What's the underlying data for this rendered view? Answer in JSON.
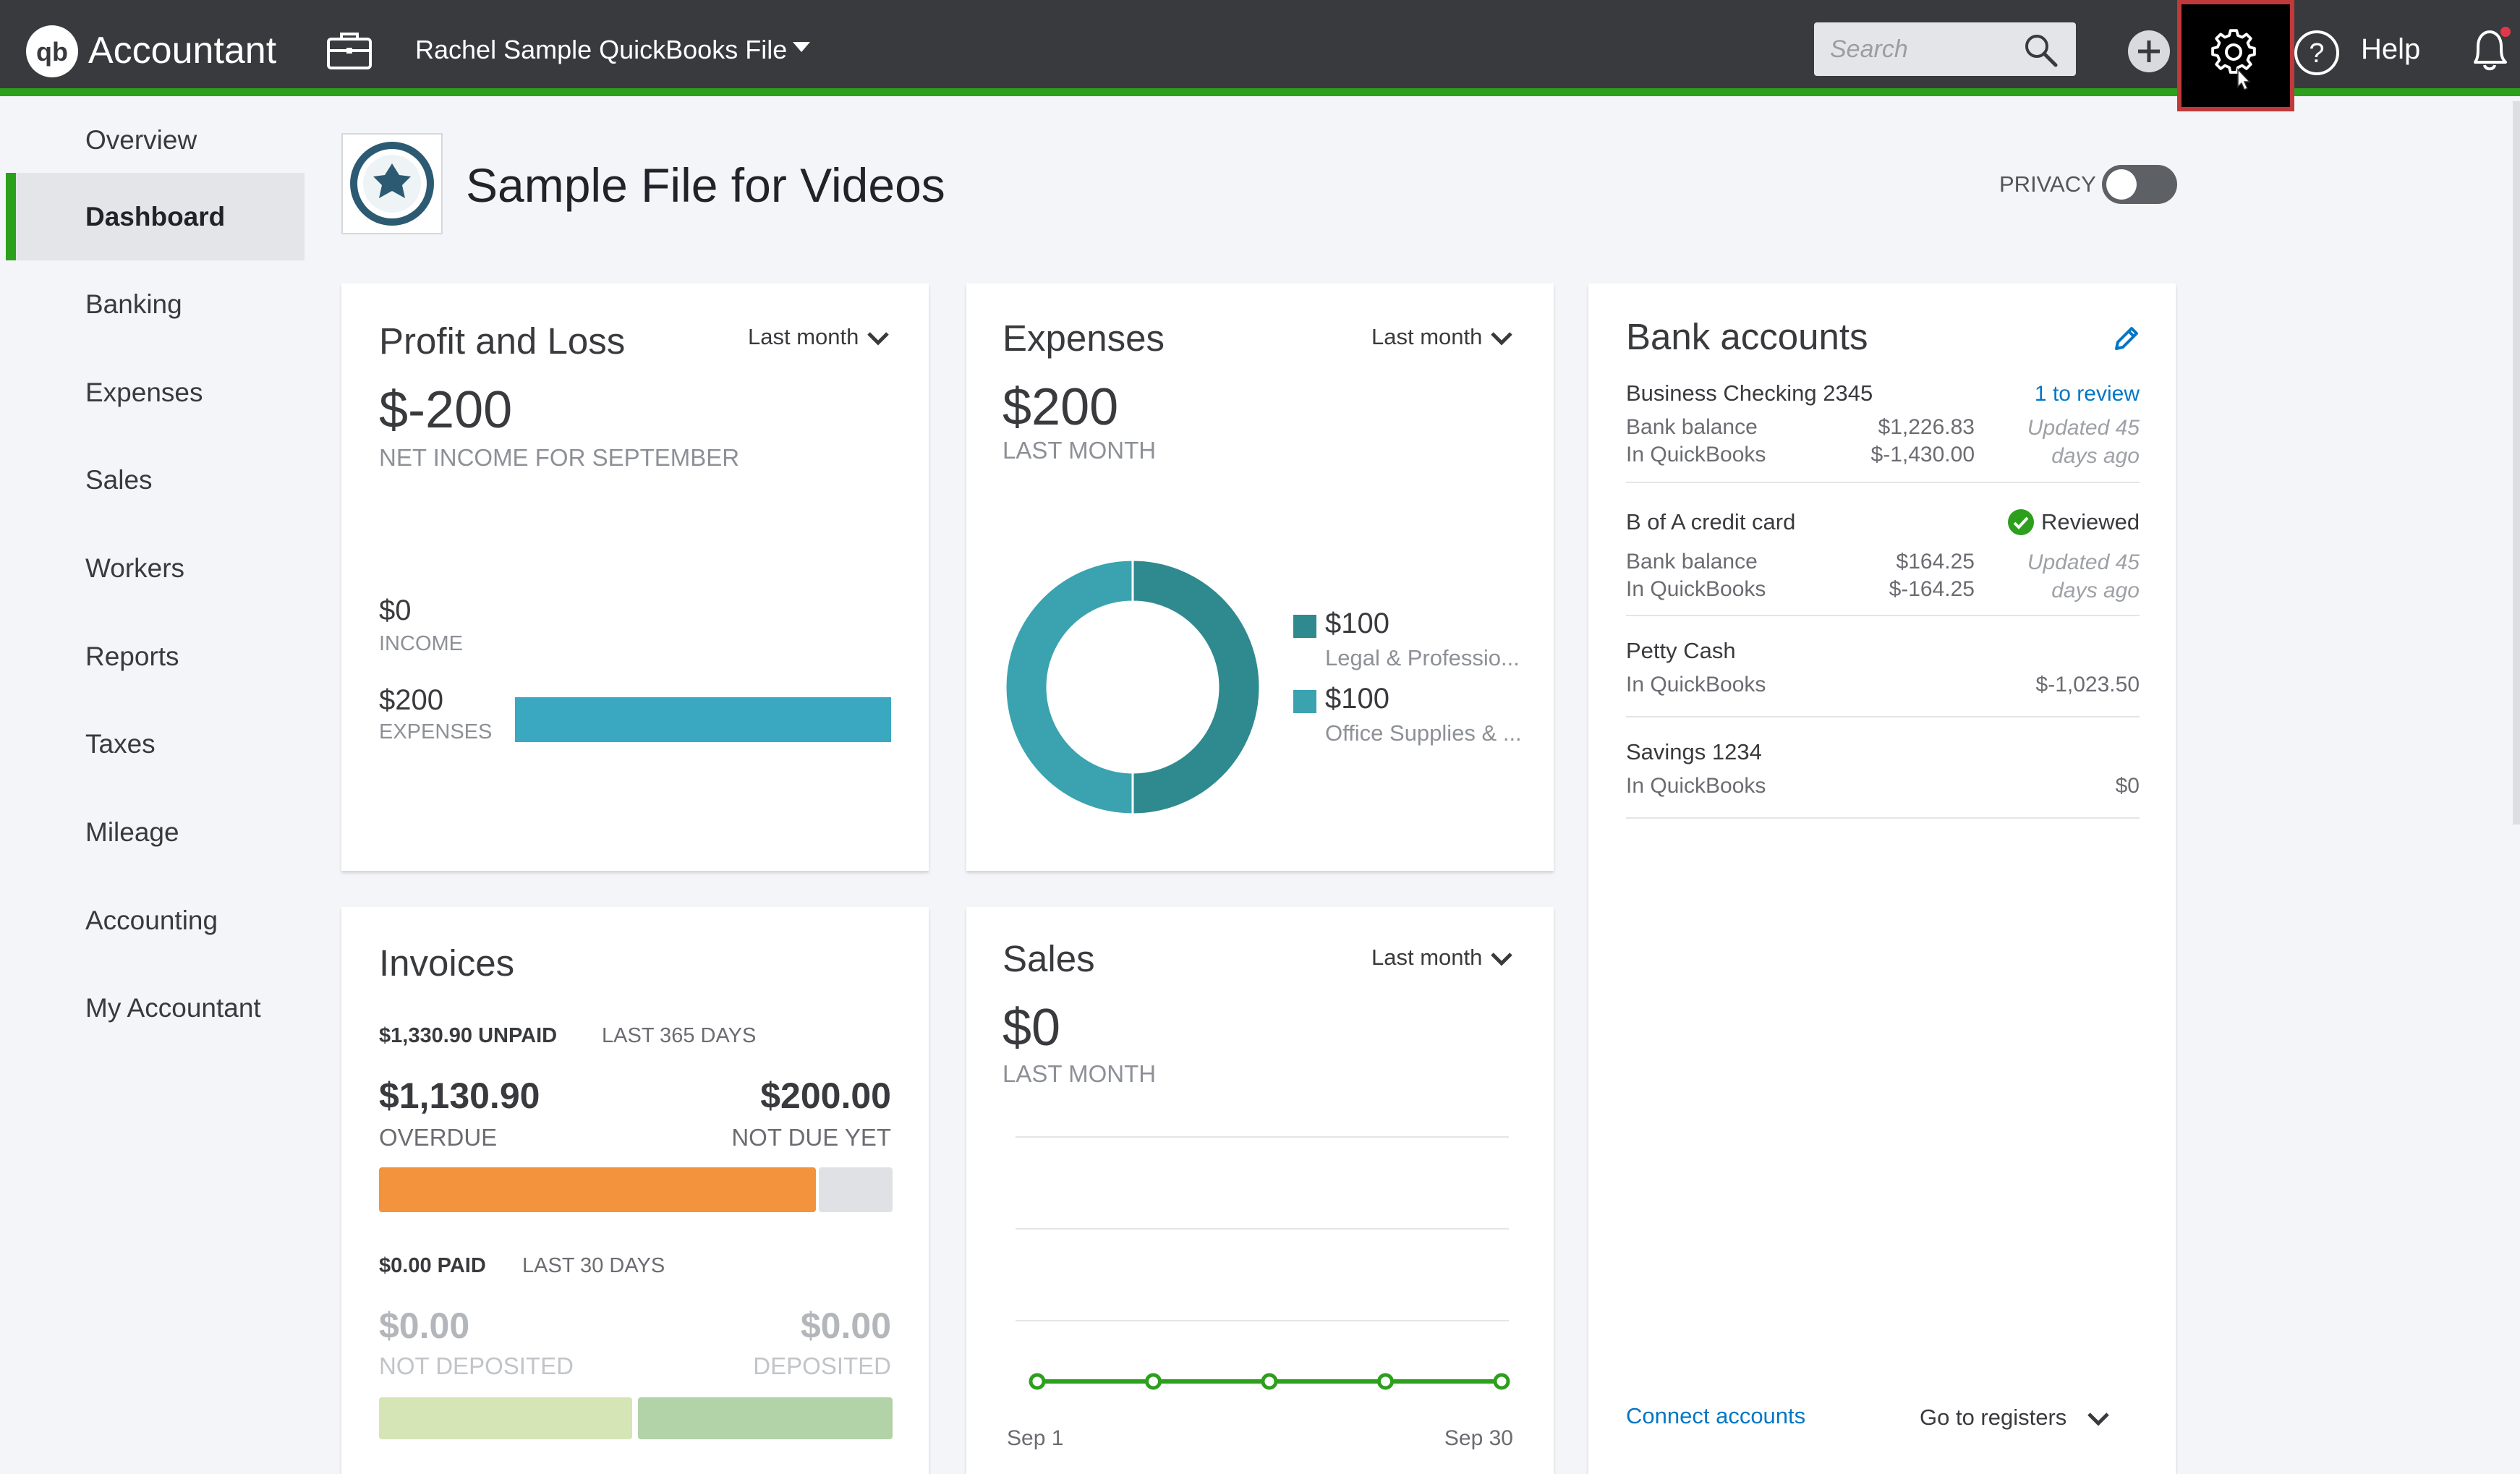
{
  "topbar": {
    "brand": "Accountant",
    "company_file": "Rachel Sample QuickBooks File",
    "search_placeholder": "Search",
    "help_label": "Help",
    "accent_color": "#2ca01c",
    "icons": [
      "qb-logo-icon",
      "briefcase-icon",
      "caret-down-icon",
      "search-icon",
      "plus-icon",
      "gear-icon",
      "help-icon",
      "bell-icon"
    ]
  },
  "nav": {
    "items": [
      {
        "label": "Overview"
      },
      {
        "label": "Dashboard",
        "active": true
      },
      {
        "label": "Banking"
      },
      {
        "label": "Expenses"
      },
      {
        "label": "Sales"
      },
      {
        "label": "Workers"
      },
      {
        "label": "Reports"
      },
      {
        "label": "Taxes"
      },
      {
        "label": "Mileage"
      },
      {
        "label": "Accounting"
      },
      {
        "label": "My Accountant"
      }
    ]
  },
  "header": {
    "title": "Sample File for Videos",
    "privacy_label": "PRIVACY",
    "privacy_on": false
  },
  "profit_loss": {
    "title": "Profit and Loss",
    "period": "Last month",
    "amount": "$-200",
    "sublabel": "NET INCOME FOR SEPTEMBER",
    "income_value": "$0",
    "income_label": "INCOME",
    "expenses_value": "$200",
    "expenses_label": "EXPENSES",
    "income_fraction": 0,
    "expenses_fraction": 1,
    "bar_color": "#3ba8c2"
  },
  "expenses": {
    "title": "Expenses",
    "period": "Last month",
    "amount": "$200",
    "sublabel": "LAST MONTH",
    "legend": [
      {
        "value": "$100",
        "name": "Legal & Professio...",
        "color": "#2f8a8f"
      },
      {
        "value": "$100",
        "name": "Office Supplies & ...",
        "color": "#3ba3b0"
      }
    ],
    "donut_values": [
      100,
      100
    ]
  },
  "bank": {
    "title": "Bank accounts",
    "accounts": [
      {
        "name": "Business Checking 2345",
        "status": "1 to review",
        "bank_balance_label": "Bank balance",
        "bank_balance": "$1,226.83",
        "qb_label": "In QuickBooks",
        "qb_balance": "$-1,430.00",
        "updated_line1": "Updated 45",
        "updated_line2": "days ago"
      },
      {
        "name": "B of A credit card",
        "status": "Reviewed",
        "bank_balance_label": "Bank balance",
        "bank_balance": "$164.25",
        "qb_label": "In QuickBooks",
        "qb_balance": "$-164.25",
        "updated_line1": "Updated 45",
        "updated_line2": "days ago"
      },
      {
        "name": "Petty Cash",
        "qb_label": "In QuickBooks",
        "qb_balance": "$-1,023.50"
      },
      {
        "name": "Savings 1234",
        "qb_label": "In QuickBooks",
        "qb_balance": "$0"
      }
    ],
    "connect_label": "Connect accounts",
    "registers_label": "Go to registers"
  },
  "invoices": {
    "title": "Invoices",
    "unpaid_amount": "$1,330.90 UNPAID",
    "unpaid_range": "LAST 365 DAYS",
    "overdue_amount": "$1,130.90",
    "overdue_label": "OVERDUE",
    "notdue_amount": "$200.00",
    "notdue_label": "NOT DUE YET",
    "paid_amount": "$0.00 PAID",
    "paid_range": "LAST 30 DAYS",
    "notdeposited_amount": "$0.00",
    "notdeposited_label": "NOT DEPOSITED",
    "deposited_amount": "$0.00",
    "deposited_label": "DEPOSITED",
    "overdue_fraction": 0.85,
    "overdue_color": "#f4933d",
    "notdue_color": "#dfe1e4",
    "notdeposited_color": "#d5e5b6",
    "deposited_color": "#b2d3a8"
  },
  "sales": {
    "title": "Sales",
    "period": "Last month",
    "amount": "$0",
    "sublabel": "LAST MONTH",
    "x_start": "Sep 1",
    "x_end": "Sep 30",
    "line_color": "#2ca01c",
    "points": [
      0,
      0,
      0,
      0,
      0
    ]
  }
}
